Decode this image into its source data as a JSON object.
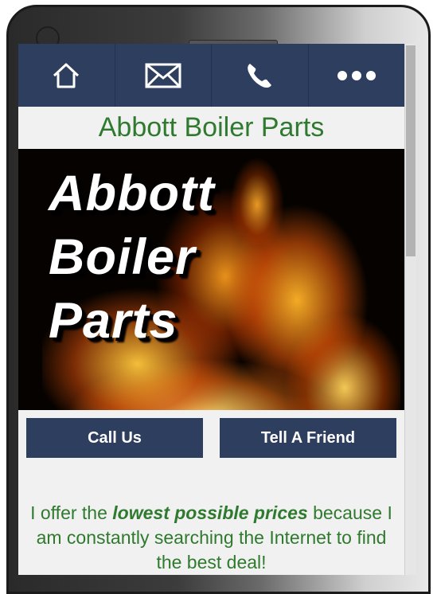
{
  "nav": {
    "home_icon": "home-icon",
    "mail_icon": "mail-icon",
    "phone_icon": "phone-icon",
    "more_icon": "more-dots-icon",
    "accent_color": "#2d3e5e"
  },
  "header": {
    "title": "Abbott Boiler Parts",
    "title_color": "#2f7a2f"
  },
  "hero": {
    "line1": "Abbott",
    "line2": "Boiler",
    "line3": "Parts"
  },
  "buttons": {
    "call_label": "Call Us",
    "tell_label": "Tell A Friend"
  },
  "intro": {
    "prefix": "I offer the ",
    "emphasis": "lowest possible prices",
    "suffix": " because I am constantly searching the Internet to find the best deal!"
  }
}
